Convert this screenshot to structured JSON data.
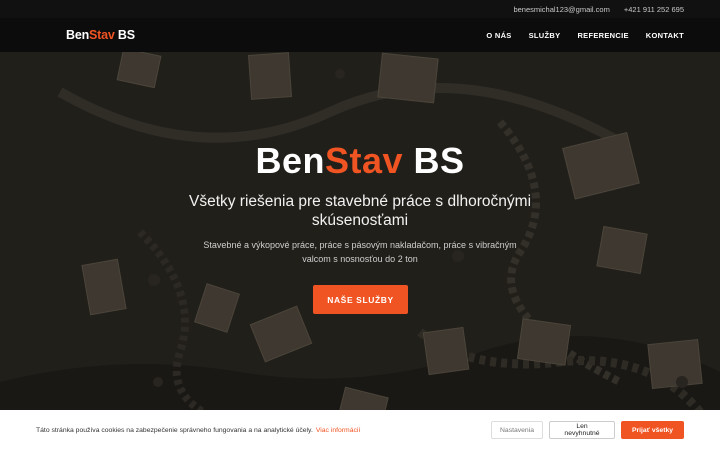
{
  "topbar": {
    "email": "benesmichal123@gmail.com",
    "phone": "+421 911 252 695"
  },
  "logo": {
    "part1": "Ben",
    "part2": "Stav",
    "part3": " BS"
  },
  "nav": {
    "items": [
      "O NÁS",
      "SLUŽBY",
      "REFERENCIE",
      "KONTAKT"
    ]
  },
  "hero": {
    "title_part1": "Ben",
    "title_part2": "Stav",
    "title_part3": " BS",
    "subtitle": "Všetky riešenia pre stavebné práce s dlhoročnými skúsenosťami",
    "description": "Stavebné a výkopové práce, práce s pásovým nakladačom, práce s vibračným valcom s nosnosťou do 2 ton",
    "cta_label": "NAŠE SLUŽBY"
  },
  "cookie": {
    "text": "Táto stránka používa cookies na zabezpečenie správneho fungovania a na analytické účely.",
    "link_label": "Viac informácií",
    "settings_label": "Nastavenia",
    "necessary_label": "Len nevyhnutné",
    "accept_label": "Prijať všetky"
  },
  "colors": {
    "accent": "#f05423",
    "nav_bg": "#0c0c0c",
    "topbar_bg": "#111111"
  }
}
